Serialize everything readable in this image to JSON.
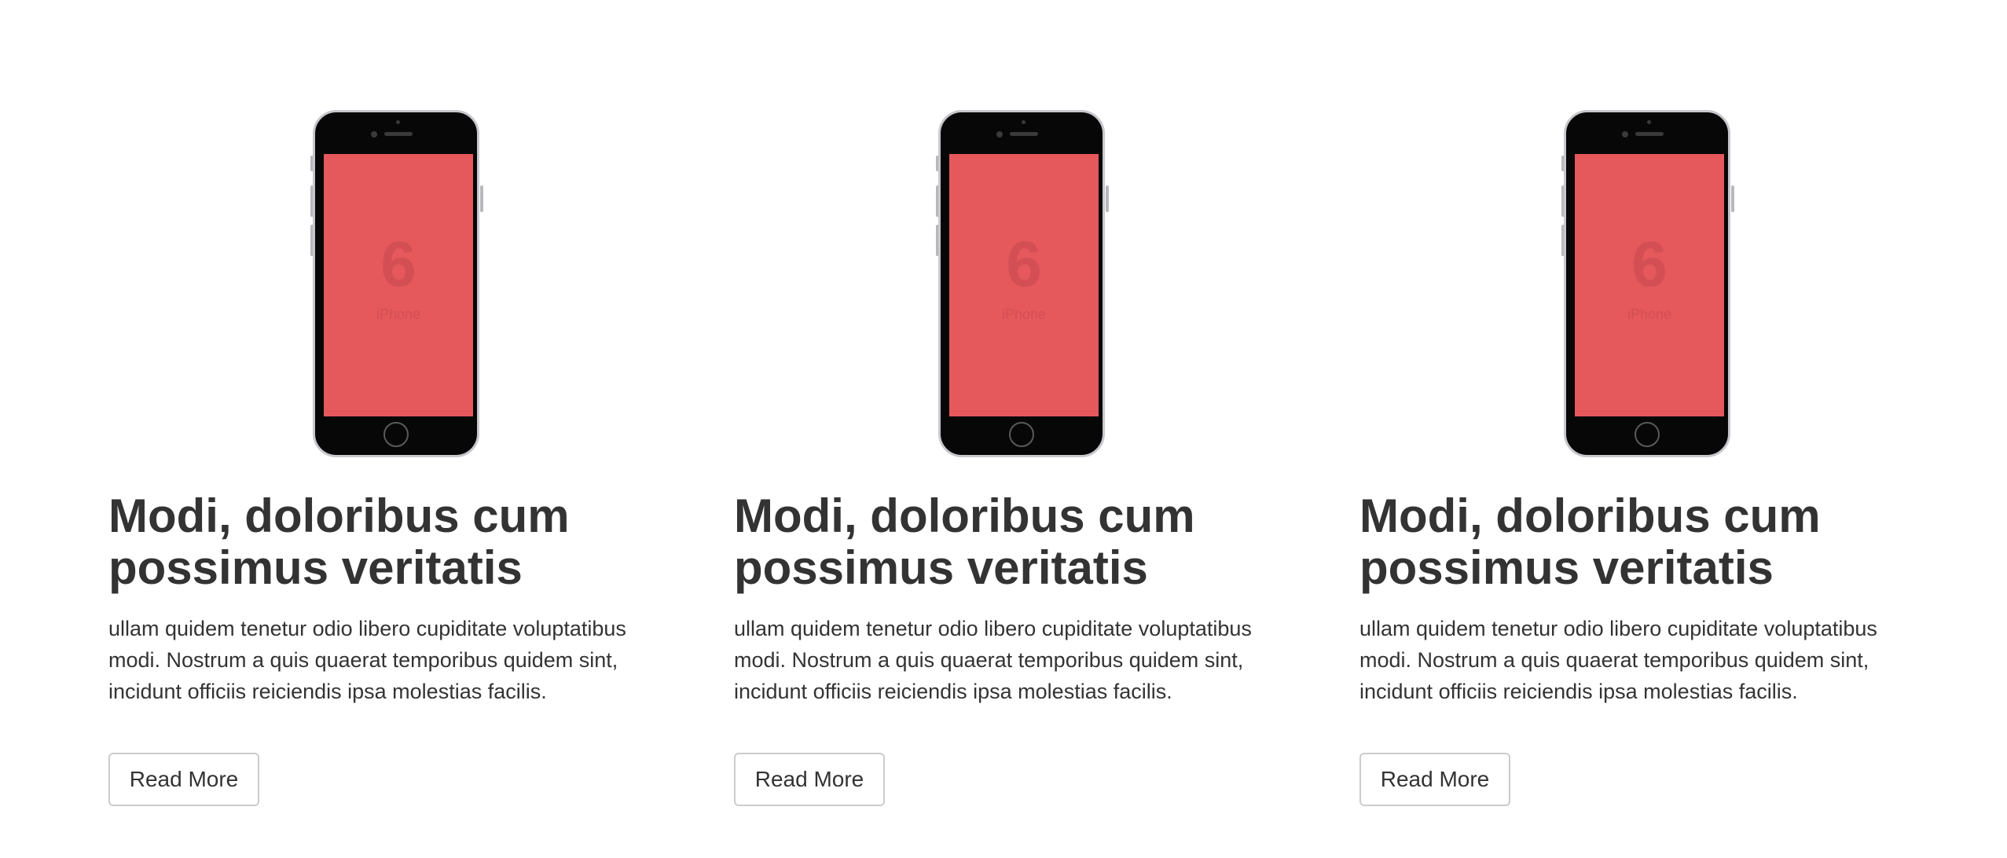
{
  "cards": [
    {
      "phone_screen_number": "6",
      "phone_screen_word": "iPhone",
      "title": "Modi, doloribus cum possimus veritatis",
      "text": "ullam quidem tenetur odio libero cupiditate voluptatibus modi. Nostrum a quis quaerat temporibus quidem sint, incidunt officiis reiciendis ipsa molestias facilis.",
      "button_label": "Read More"
    },
    {
      "phone_screen_number": "6",
      "phone_screen_word": "iPhone",
      "title": "Modi, doloribus cum possimus veritatis",
      "text": "ullam quidem tenetur odio libero cupiditate voluptatibus modi. Nostrum a quis quaerat temporibus quidem sint, incidunt officiis reiciendis ipsa molestias facilis.",
      "button_label": "Read More"
    },
    {
      "phone_screen_number": "6",
      "phone_screen_word": "iPhone",
      "title": "Modi, doloribus cum possimus veritatis",
      "text": "ullam quidem tenetur odio libero cupiditate voluptatibus modi. Nostrum a quis quaerat temporibus quidem sint, incidunt officiis reiciendis ipsa molestias facilis.",
      "button_label": "Read More"
    }
  ],
  "colors": {
    "screen": "#e5585c",
    "phone_body": "#070707",
    "text": "#333333",
    "button_border": "#cccccc"
  }
}
